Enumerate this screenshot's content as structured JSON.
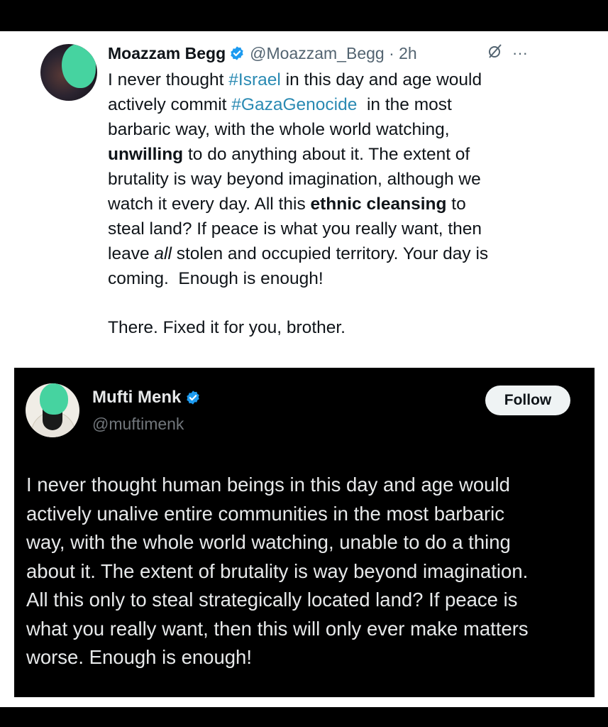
{
  "tweet1": {
    "name": "Moazzam Begg",
    "handle_time": "@Moazzam_Begg · 2h",
    "more": "···",
    "lines": [
      [
        {
          "t": "I never thought "
        },
        {
          "t": "#Israel",
          "c": "tag"
        },
        {
          "t": " in this day and age would"
        }
      ],
      [
        {
          "t": "actively commit "
        },
        {
          "t": "#GazaGenocide",
          "c": "tag"
        },
        {
          "t": "  in the most"
        }
      ],
      [
        {
          "t": "barbaric way, with the whole world watching,"
        }
      ],
      [
        {
          "t": "unwilling",
          "c": "b"
        },
        {
          "t": " to do anything about it. The extent of"
        }
      ],
      [
        {
          "t": "brutality is way beyond imagination, although we"
        }
      ],
      [
        {
          "t": "watch it every day. All this "
        },
        {
          "t": "ethnic cleansing",
          "c": "b"
        },
        {
          "t": " to"
        }
      ],
      [
        {
          "t": "steal land? If peace is what you really want, then"
        }
      ],
      [
        {
          "t": "leave "
        },
        {
          "t": "all",
          "c": "i"
        },
        {
          "t": " stolen and occupied territory. Your day is"
        }
      ],
      [
        {
          "t": "coming.  Enough is enough!"
        }
      ]
    ],
    "fixed": "There. Fixed it for you, brother."
  },
  "tweet2": {
    "name": "Mufti Menk",
    "handle": "@muftimenk",
    "follow": "Follow",
    "lines": [
      "I never thought human beings in this day and age would",
      "actively unalive entire communities in the most barbaric",
      "way, with the whole world watching, unable to do a thing",
      "about it. The extent of brutality is way beyond imagination.",
      "All this only to steal strategically located land? If peace is",
      "what you really want, then this will only ever make matters",
      "worse. Enough is enough!"
    ]
  },
  "colors": {
    "hashtag": "#2a8ab3",
    "verified": "#1d9bf0",
    "avatar_blur": "#46d3a0"
  },
  "icons": [
    "verified-badge-icon",
    "grok-icon",
    "more-options-icon"
  ]
}
